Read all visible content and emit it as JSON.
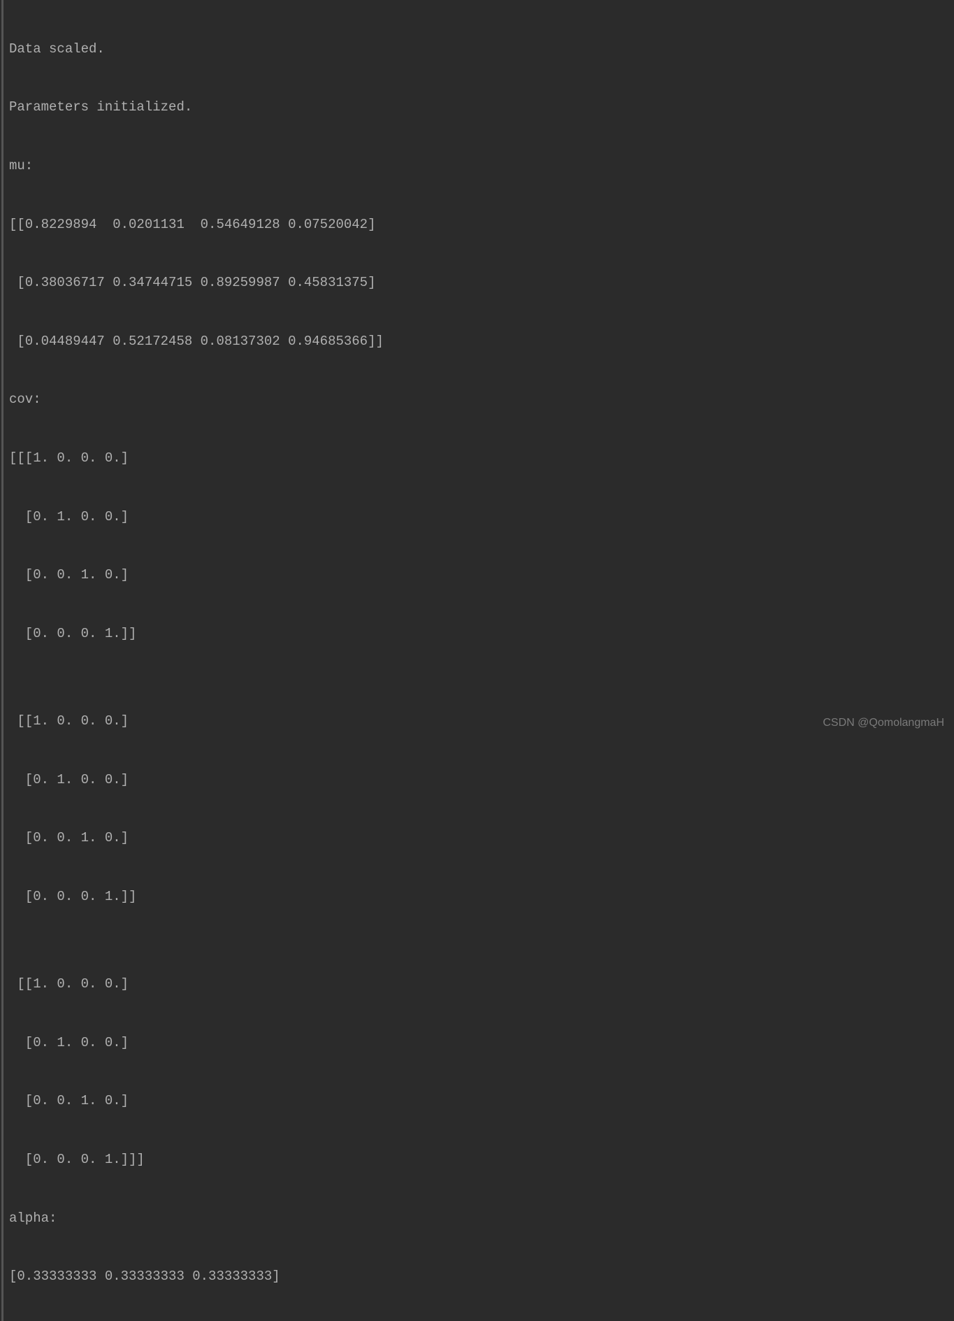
{
  "terminal": {
    "lines": [
      "Data scaled.",
      "Parameters initialized.",
      "mu:",
      "[[0.8229894  0.0201131  0.54649128 0.07520042]",
      " [0.38036717 0.34744715 0.89259987 0.45831375]",
      " [0.04489447 0.52172458 0.08137302 0.94685366]]",
      "cov:",
      "[[[1. 0. 0. 0.]",
      "  [0. 1. 0. 0.]",
      "  [0. 0. 1. 0.]",
      "  [0. 0. 0. 1.]]",
      "",
      " [[1. 0. 0. 0.]",
      "  [0. 1. 0. 0.]",
      "  [0. 0. 1. 0.]",
      "  [0. 0. 0. 1.]]",
      "",
      " [[1. 0. 0. 0.]",
      "  [0. 1. 0. 0.]",
      "  [0. 0. 1. 0.]",
      "  [0. 0. 0. 1.]]]",
      "alpha:",
      "[0.33333333 0.33333333 0.33333333]"
    ]
  },
  "watermark": {
    "text": "CSDN @QomolangmaH"
  }
}
